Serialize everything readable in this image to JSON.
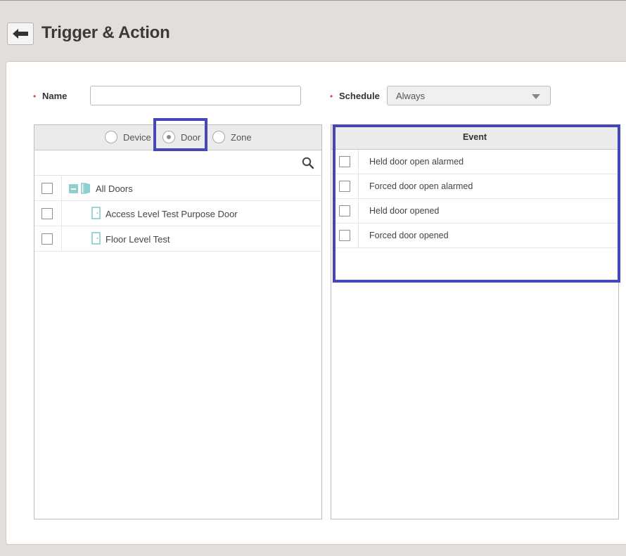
{
  "page": {
    "title": "Trigger & Action"
  },
  "form": {
    "required_mark": "•",
    "name_label": "Name",
    "name_value": "",
    "schedule_label": "Schedule",
    "schedule_value": "Always"
  },
  "type_selector": {
    "options": [
      {
        "label": "Device",
        "checked": false
      },
      {
        "label": "Door",
        "checked": true
      },
      {
        "label": "Zone",
        "checked": false
      }
    ]
  },
  "tree": {
    "root": {
      "label": "All Doors",
      "expanded": true,
      "icon": "door-group-icon"
    },
    "items": [
      {
        "label": "Access Level Test Purpose Door",
        "icon": "door-icon"
      },
      {
        "label": "Floor Level Test",
        "icon": "door-icon"
      }
    ]
  },
  "events": {
    "header": "Event",
    "rows": [
      {
        "label": "Held door open alarmed"
      },
      {
        "label": "Forced door open alarmed"
      },
      {
        "label": "Held door opened"
      },
      {
        "label": "Forced door opened"
      }
    ]
  },
  "colors": {
    "highlight": "#4646b9",
    "door_icon": "#7fc6c6",
    "required": "#e0443b"
  }
}
